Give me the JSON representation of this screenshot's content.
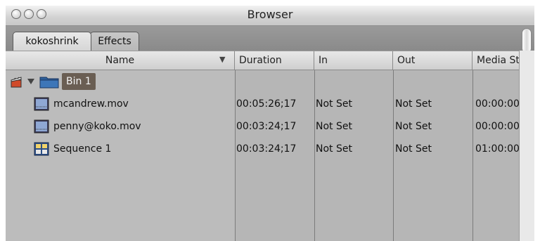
{
  "window": {
    "title": "Browser"
  },
  "tabs": [
    {
      "label": "kokoshrink",
      "active": true
    },
    {
      "label": "Effects",
      "active": false
    }
  ],
  "columns": [
    "Name",
    "Duration",
    "In",
    "Out",
    "Media St"
  ],
  "rows": [
    {
      "type": "bin",
      "icon": "folder-icon",
      "name": "Bin 1",
      "duration": "",
      "in": "",
      "out": "",
      "media_start": ""
    },
    {
      "type": "clip",
      "icon": "clip-icon",
      "name": "mcandrew.mov",
      "duration": "00:05:26;17",
      "in": "Not Set",
      "out": "Not Set",
      "media_start": "00:00:00"
    },
    {
      "type": "clip",
      "icon": "clip-icon",
      "name": "penny@koko.mov",
      "duration": "00:03:24;17",
      "in": "Not Set",
      "out": "Not Set",
      "media_start": "00:00:00"
    },
    {
      "type": "sequence",
      "icon": "sequence-icon",
      "name": "Sequence 1",
      "duration": "00:03:24;17",
      "in": "Not Set",
      "out": "Not Set",
      "media_start": "01:00:00"
    }
  ],
  "colors": {
    "bin_highlight": "#6a5e53",
    "list_bg": "#b6b6b6",
    "name_col_bg": "#bcbcbc"
  }
}
